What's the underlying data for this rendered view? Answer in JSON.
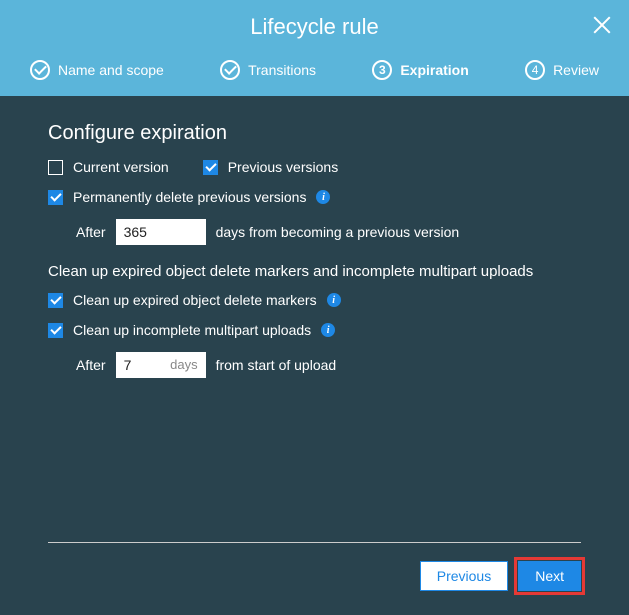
{
  "header": {
    "title": "Lifecycle rule",
    "steps": [
      {
        "label": "Name and scope",
        "state": "done"
      },
      {
        "label": "Transitions",
        "state": "done"
      },
      {
        "label": "Expiration",
        "num": "3",
        "state": "active"
      },
      {
        "label": "Review",
        "num": "4",
        "state": "pending"
      }
    ]
  },
  "section": {
    "title": "Configure expiration",
    "currentVersion": {
      "label": "Current version",
      "checked": false
    },
    "previousVersions": {
      "label": "Previous versions",
      "checked": true
    },
    "permDelete": {
      "label": "Permanently delete previous versions",
      "checked": true,
      "afterLabel": "After",
      "daysValue": "365",
      "suffix": "days from becoming a previous version"
    },
    "cleanup": {
      "title": "Clean up expired object delete markers and incomplete multipart uploads",
      "deleteMarkers": {
        "label": "Clean up expired object delete markers",
        "checked": true
      },
      "multipart": {
        "label": "Clean up incomplete multipart uploads",
        "checked": true,
        "afterLabel": "After",
        "daysValue": "7",
        "unit": "days",
        "suffix": "from start of upload"
      }
    }
  },
  "footer": {
    "previous": "Previous",
    "next": "Next"
  }
}
